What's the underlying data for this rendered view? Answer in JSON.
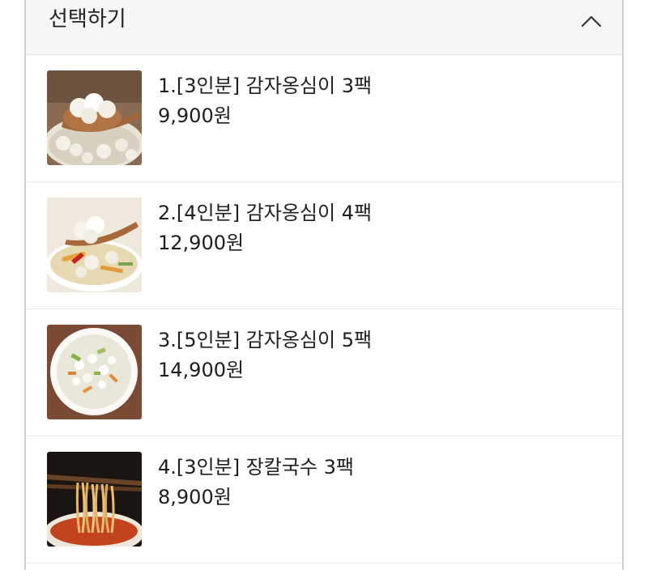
{
  "header": {
    "title": "선택하기",
    "toggle_icon": "chevron-up-icon"
  },
  "options": [
    {
      "name": "1.[3인분] 감자옹심이 3팩",
      "price": "9,900원",
      "image": "potato-dumpling-soup-spoon"
    },
    {
      "name": "2.[4인분] 감자옹심이 4팩",
      "price": "12,900원",
      "image": "potato-dumpling-soup-bowl"
    },
    {
      "name": "3.[5인분] 감자옹심이 5팩",
      "price": "14,900원",
      "image": "potato-dumpling-soup-top"
    },
    {
      "name": "4.[3인분] 장칼국수 3팩",
      "price": "8,900원",
      "image": "spicy-noodles-chopsticks"
    }
  ],
  "colors": {
    "header_bg": "#f6f6f6",
    "border": "#cfcfcf",
    "text": "#1e1e1e"
  }
}
